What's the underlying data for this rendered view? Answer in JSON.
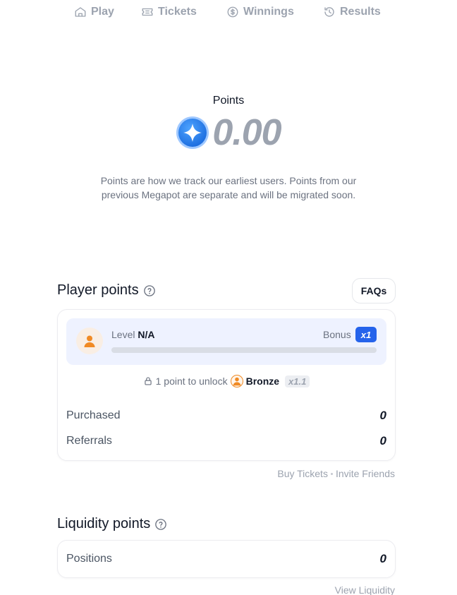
{
  "nav": {
    "play": "Play",
    "tickets": "Tickets",
    "winnings": "Winnings",
    "results": "Results"
  },
  "hero": {
    "label": "Points",
    "value": "0.00",
    "description": "Points are how we track our earliest users. Points from our previous Megapot are separate and will be migrated soon."
  },
  "player_points": {
    "title": "Player points",
    "faq_label": "FAQs",
    "level_label": "Level",
    "level_value": "N/A",
    "bonus_label": "Bonus",
    "bonus_value": "x1",
    "progress": 0,
    "unlock_text": "1 point to unlock",
    "next_tier": "Bronze",
    "next_tier_multiplier": "x1.1",
    "stats": [
      {
        "label": "Purchased",
        "value": "0"
      },
      {
        "label": "Referrals",
        "value": "0"
      }
    ],
    "links": {
      "buy": "Buy Tickets",
      "invite": "Invite Friends"
    }
  },
  "liquidity_points": {
    "title": "Liquidity points",
    "positions_label": "Positions",
    "positions_value": "0",
    "view_link": "View Liquidity"
  },
  "colors": {
    "accent": "#2563eb",
    "muted": "#9ca3af",
    "level_bg": "#eef2ff",
    "bronze": "#f08a24"
  }
}
